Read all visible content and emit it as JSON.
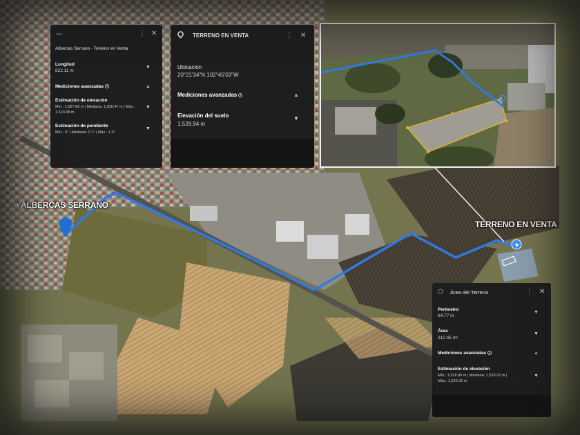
{
  "colors": {
    "route": "#2f7ae5",
    "panel_bg": "#1e1e1f",
    "accent": "#8ab4f8",
    "plot_outline": "#e6b422"
  },
  "map": {
    "label_origin": "ALBERCAS SERRANO",
    "label_destination": "TERRENO EN VENTA"
  },
  "panel_path": {
    "icon": "path-icon",
    "title": "Albercas Serrano - Terreno en Venta",
    "length_label": "Longitud",
    "length_value": "822.11 m",
    "advanced_label": "Mediciones avanzadas",
    "elevation_label": "Estimación de elevación",
    "elevation_value": "Mín.: 1,527.68 m | Mediana: 1,528.47 m | Máx.: 1,529.38 m",
    "slope_label": "Estimación de pendiente",
    "slope_value": "Mín.: 0° | Mediana: 0.1° | Máx.: 1.5°"
  },
  "panel_point": {
    "icon": "location-pin-icon",
    "title": "TERRENO EN VENTA",
    "location_label": "Ubicación",
    "location_value": "20°21'34\"N 102°45'03\"W",
    "advanced_label": "Mediciones avanzadas",
    "ground_label": "Elevación del suelo",
    "ground_value": "1,528.94 m"
  },
  "panel_area": {
    "icon": "polygon-icon",
    "title": "Área del Terreno",
    "perimeter_label": "Perímetro",
    "perimeter_value": "64.77 m",
    "area_label": "Área",
    "area_value": "210.45 m²",
    "advanced_label": "Mediciones avanzadas",
    "elevation_label": "Estimación de elevación",
    "elevation_value_line1": "Mín.: 1,528.86 m | Mediana: 1,529.02 m |",
    "elevation_value_line2": "Máx.: 1,529.32 m"
  }
}
